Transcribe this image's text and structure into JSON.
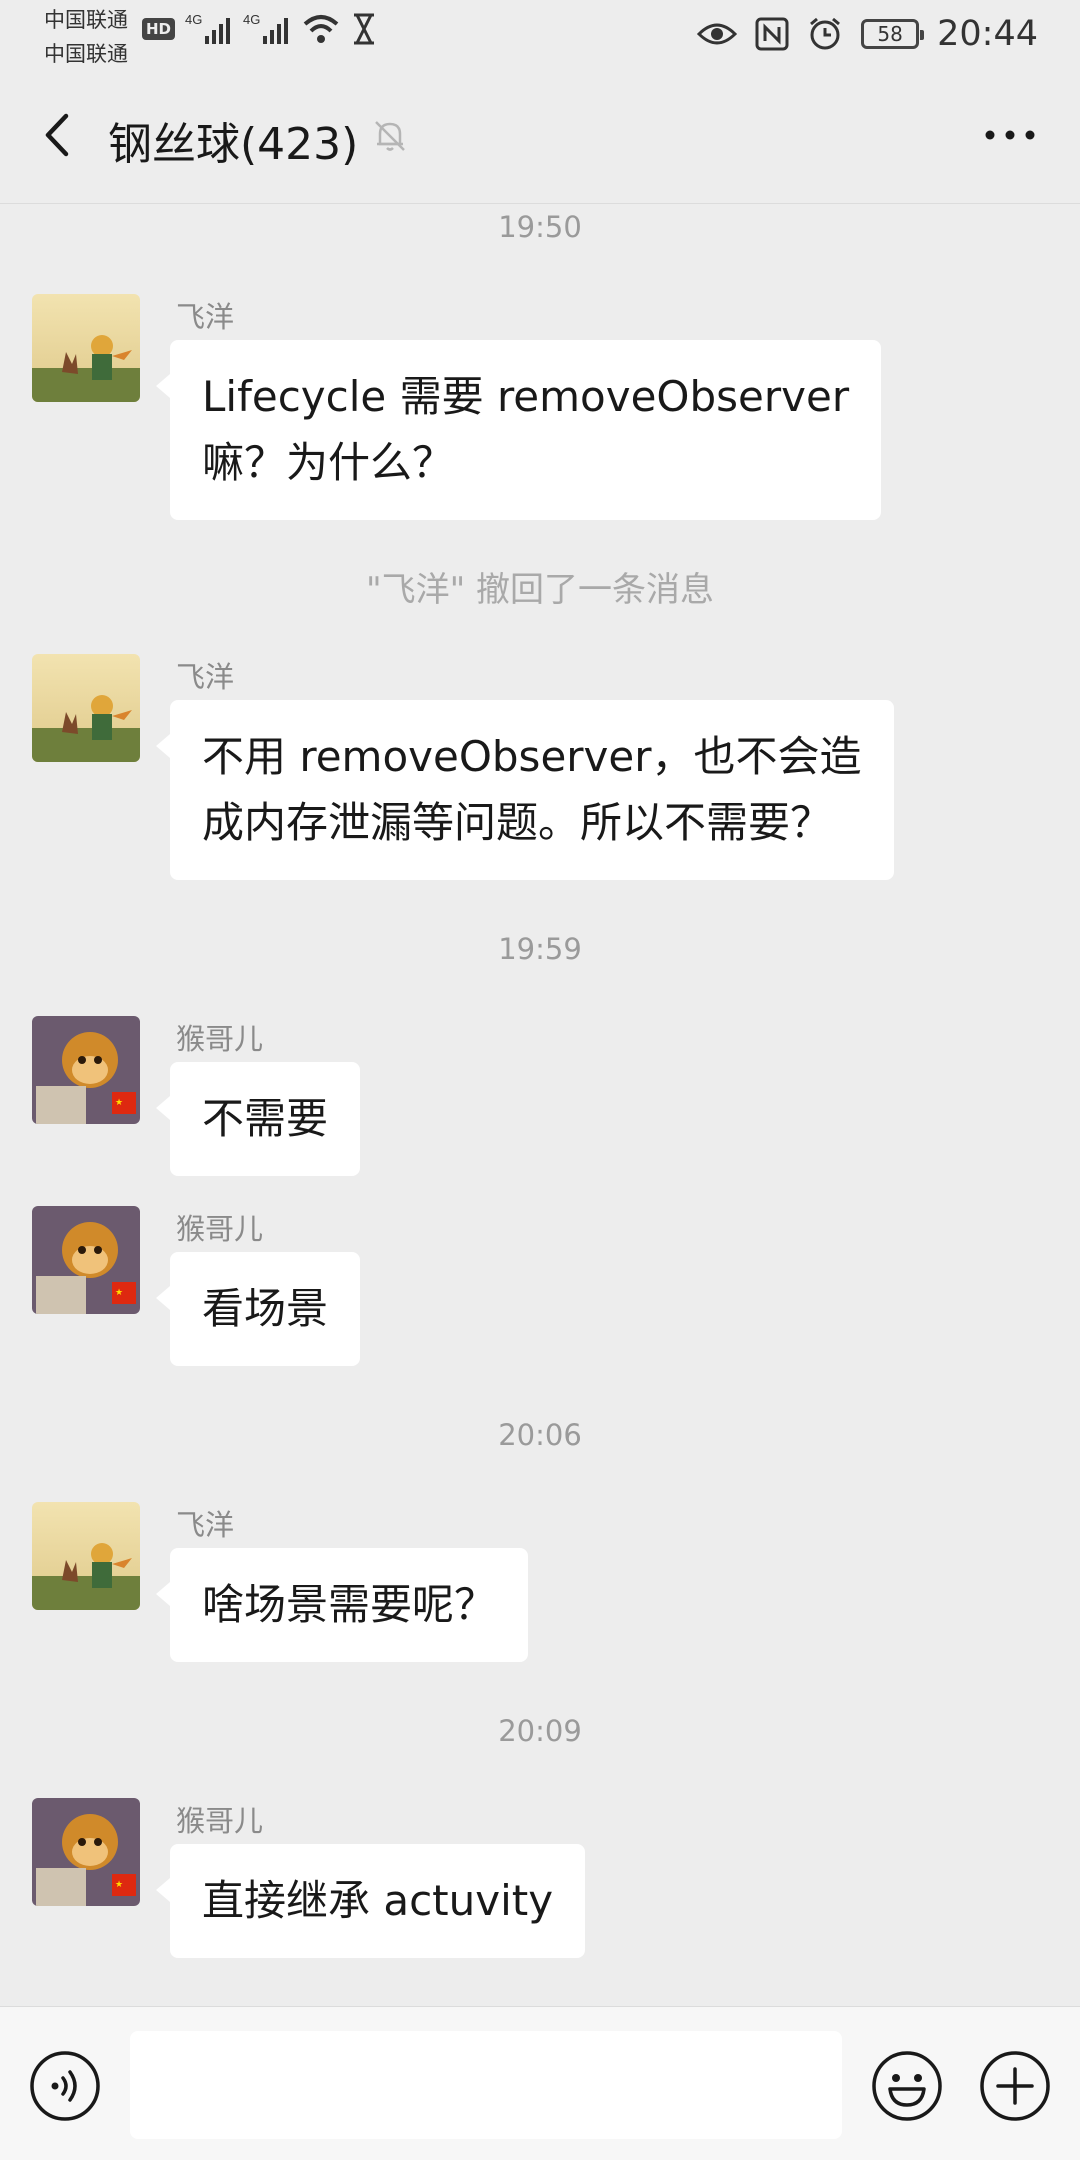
{
  "status_bar": {
    "carrier1": "中国联通",
    "carrier2": "中国联通",
    "hd": "HD",
    "network1": "4G",
    "network2": "4G",
    "battery": "58",
    "time": "20:44"
  },
  "header": {
    "title": "钢丝球(423)"
  },
  "chat": {
    "ts1": "19:50",
    "m1": {
      "sender": "飞洋",
      "line1": "Lifecycle 需要 removeObserver",
      "line2": "嘛？为什么？"
    },
    "notice": "\"飞洋\" 撤回了一条消息",
    "m2": {
      "sender": "飞洋",
      "line1": "不用 removeObserver，也不会造",
      "line2": "成内存泄漏等问题。所以不需要？"
    },
    "ts2": "19:59",
    "m3": {
      "sender": "猴哥儿",
      "text": "不需要"
    },
    "m4": {
      "sender": "猴哥儿",
      "text": "看场景"
    },
    "ts3": "20:06",
    "m5": {
      "sender": "飞洋",
      "text": "啥场景需要呢？"
    },
    "ts4": "20:09",
    "m6": {
      "sender": "猴哥儿",
      "text": "直接继承 actuvity"
    }
  },
  "footer": {
    "input_value": ""
  },
  "colors": {
    "background": "#ededed",
    "bubble": "#ffffff",
    "muted_text": "#9a9a9a"
  }
}
